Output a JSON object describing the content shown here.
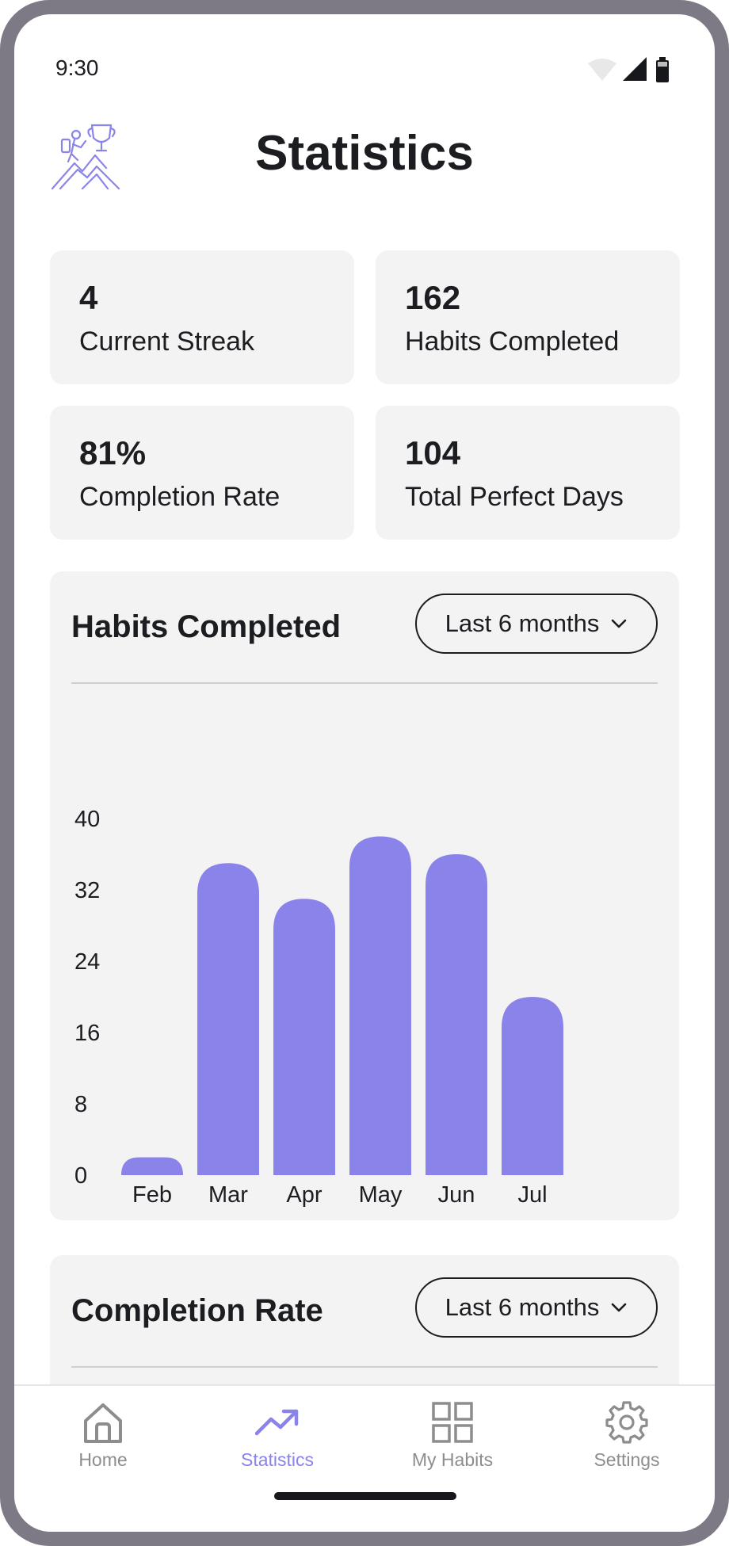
{
  "status": {
    "time": "9:30"
  },
  "header": {
    "title": "Statistics",
    "logo": "climber-trophy-icon"
  },
  "stats": [
    {
      "value": "4",
      "label": "Current Streak"
    },
    {
      "value": "162",
      "label": "Habits Completed"
    },
    {
      "value": "81%",
      "label": "Completion Rate"
    },
    {
      "value": "104",
      "label": "Total Perfect Days"
    }
  ],
  "habits_panel": {
    "title": "Habits Completed",
    "range": "Last 6 months"
  },
  "rate_panel": {
    "title": "Completion Rate",
    "range": "Last 6 months"
  },
  "chart_data": {
    "type": "bar",
    "categories": [
      "Feb",
      "Mar",
      "Apr",
      "May",
      "Jun",
      "Jul"
    ],
    "values": [
      2,
      35,
      31,
      38,
      36,
      20
    ],
    "yticks": [
      0,
      8,
      16,
      24,
      32,
      40
    ],
    "ylim": [
      0,
      40
    ],
    "title": "",
    "xlabel": "",
    "ylabel": "",
    "grid": false,
    "bar_color": "#8a84ea"
  },
  "tabs": [
    {
      "label": "Home",
      "icon": "home-icon"
    },
    {
      "label": "Statistics",
      "icon": "trend-up-icon",
      "active": true
    },
    {
      "label": "My Habits",
      "icon": "grid-icon"
    },
    {
      "label": "Settings",
      "icon": "gear-icon"
    }
  ],
  "colors": {
    "accent": "#8a84ea",
    "card": "#f3f3f3",
    "frame": "#7d7a86"
  }
}
